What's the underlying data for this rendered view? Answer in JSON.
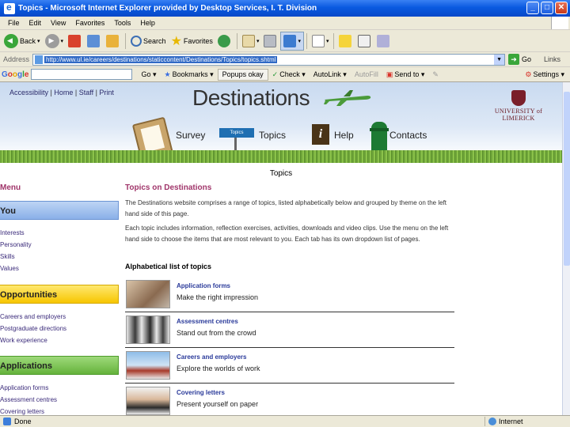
{
  "window": {
    "title": "Topics - Microsoft Internet Explorer provided by Desktop Services, I. T. Division"
  },
  "menubar": [
    "File",
    "Edit",
    "View",
    "Favorites",
    "Tools",
    "Help"
  ],
  "toolbar": {
    "back": "Back",
    "search": "Search",
    "favorites": "Favorites"
  },
  "address": {
    "label": "Address",
    "url": "http://www.ul.ie/careers/destinations/staticcontent/Destinations/Topics/topics.shtml",
    "go": "Go",
    "links": "Links"
  },
  "google": {
    "logo": "Google",
    "go": "Go",
    "bookmarks": "Bookmarks",
    "popups": "Popups okay",
    "check": "Check",
    "autolink": "AutoLink",
    "autofill": "AutoFill",
    "sendto": "Send to",
    "settings": "Settings"
  },
  "site": {
    "toplinks": [
      "Accessibility",
      "Home",
      "Staff",
      "Print"
    ],
    "title": "Destinations",
    "university": "UNIVERSITY of LIMERICK",
    "nav": {
      "survey": "Survey",
      "topics": "Topics",
      "help": "Help",
      "contacts": "Contacts",
      "sign": "Topics"
    }
  },
  "page": {
    "heading": "Topics"
  },
  "menu": {
    "label": "Menu",
    "you": {
      "title": "You",
      "links": [
        "Interests",
        "Personality",
        "Skills",
        "Values"
      ]
    },
    "opportunities": {
      "title": "Opportunities",
      "links": [
        "Careers and employers",
        "Postgraduate directions",
        "Work experience"
      ]
    },
    "applications": {
      "title": "Applications",
      "links": [
        "Application forms",
        "Assessment centres",
        "Covering letters"
      ]
    }
  },
  "main": {
    "title": "Topics on Destinations",
    "para1": "The Destinations website comprises a range of topics, listed alphabetically below and grouped by theme on the left hand side of this page.",
    "para2": "Each topic includes information, reflection exercises, activities, downloads and video clips. Use the menu on the left hand side to choose the items that are most relevant to you. Each tab has its own dropdown list of pages.",
    "alpha": "Alphabetical list of topics",
    "topics": [
      {
        "title": "Application forms",
        "sub": "Make the right impression"
      },
      {
        "title": "Assessment centres",
        "sub": "Stand out from the crowd"
      },
      {
        "title": "Careers and employers",
        "sub": "Explore the worlds of work"
      },
      {
        "title": "Covering letters",
        "sub": "Present yourself on paper"
      }
    ]
  },
  "status": {
    "left": "Done",
    "zone": "Internet"
  }
}
